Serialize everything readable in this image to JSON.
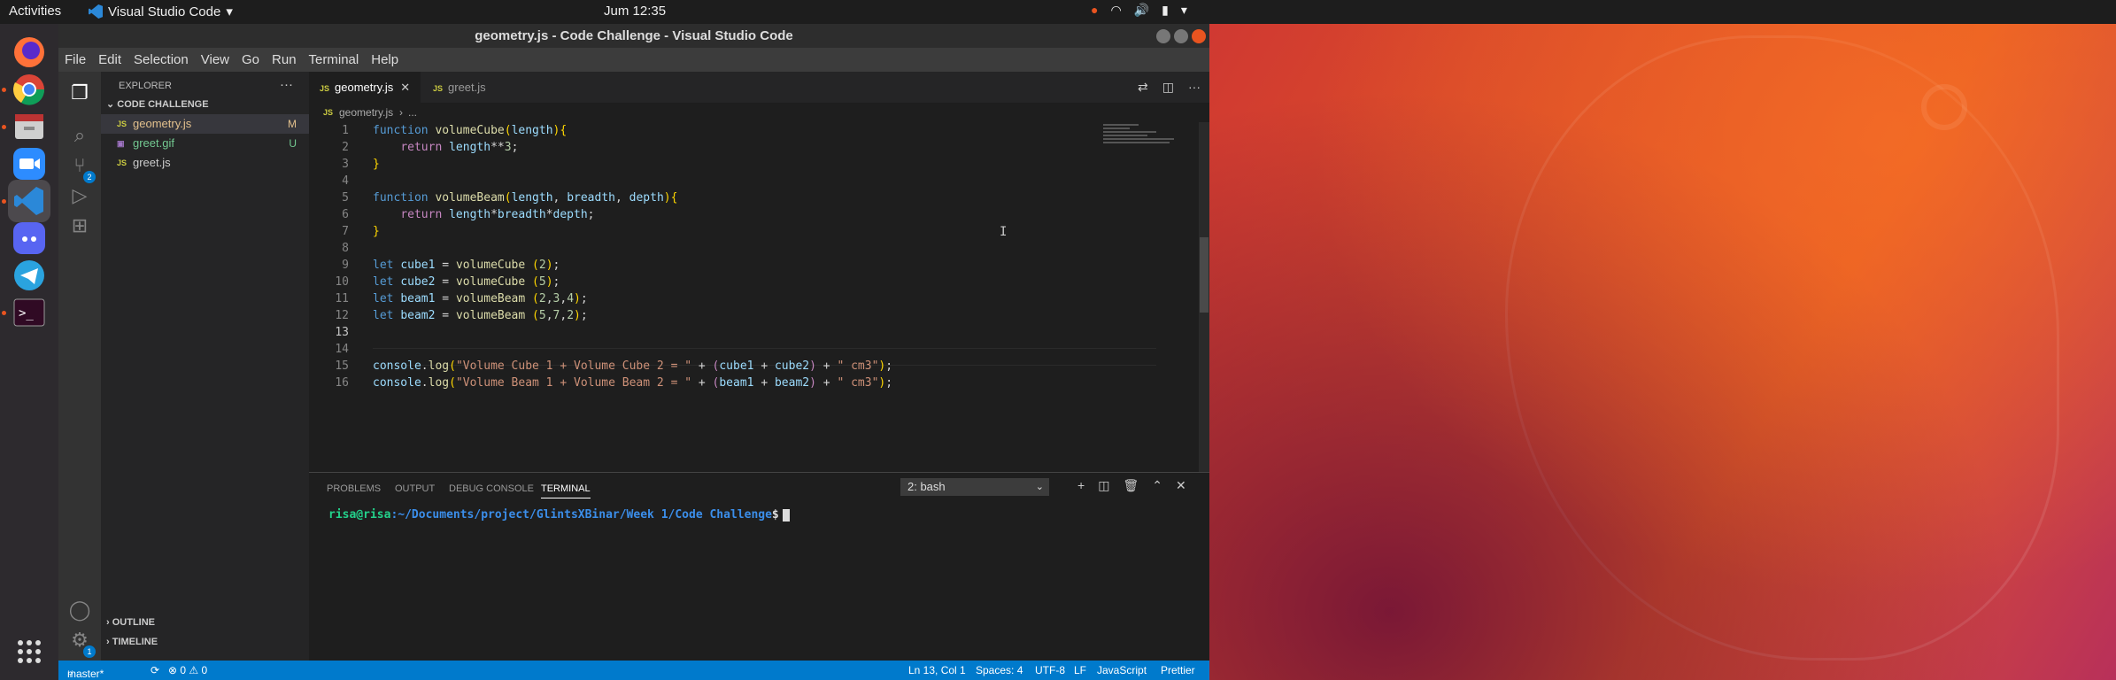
{
  "topbar": {
    "activities": "Activities",
    "app_name": "Visual Studio Code",
    "clock": "Jum 12:35"
  },
  "window": {
    "title": "geometry.js - Code Challenge - Visual Studio Code"
  },
  "menu": [
    "File",
    "Edit",
    "Selection",
    "View",
    "Go",
    "Run",
    "Terminal",
    "Help"
  ],
  "explorer": {
    "header": "EXPLORER",
    "folder": "CODE CHALLENGE",
    "files": [
      {
        "icon": "JS",
        "name": "geometry.js",
        "status": "M",
        "color": "#e2c08d"
      },
      {
        "icon": "image",
        "name": "greet.gif",
        "status": "U",
        "color": "#73c991"
      },
      {
        "icon": "JS",
        "name": "greet.js",
        "status": "",
        "color": "#cccccc"
      }
    ],
    "outline": "OUTLINE",
    "timeline": "TIMELINE"
  },
  "activitybar": {
    "scm_badge": "2",
    "settings_badge": "1"
  },
  "tabs": [
    {
      "label": "geometry.js",
      "active": true
    },
    {
      "label": "greet.js",
      "active": false
    }
  ],
  "breadcrumb": {
    "file": "geometry.js",
    "rest": "..."
  },
  "code": {
    "line_numbers": [
      "1",
      "2",
      "3",
      "4",
      "5",
      "6",
      "7",
      "8",
      "9",
      "10",
      "11",
      "12",
      "13",
      "14",
      "15",
      "16"
    ]
  },
  "panel": {
    "tabs": [
      "PROBLEMS",
      "OUTPUT",
      "DEBUG CONSOLE",
      "TERMINAL"
    ],
    "terminal_select": "2: bash",
    "prompt_user": "risa@risa",
    "prompt_path": ":~/Documents/project/GlintsXBinar/Week 1/Code Challenge",
    "prompt_symbol": "$"
  },
  "statusbar": {
    "branch": "master*",
    "problems": "⊗ 0 ⚠ 0",
    "position": "Ln 13, Col 1",
    "spaces": "Spaces: 4",
    "encoding": "UTF-8",
    "eol": "LF",
    "language": "JavaScript",
    "formatter": "Prettier"
  },
  "colors": {
    "accent": "#007acc",
    "ubuntu_orange": "#e95420"
  }
}
